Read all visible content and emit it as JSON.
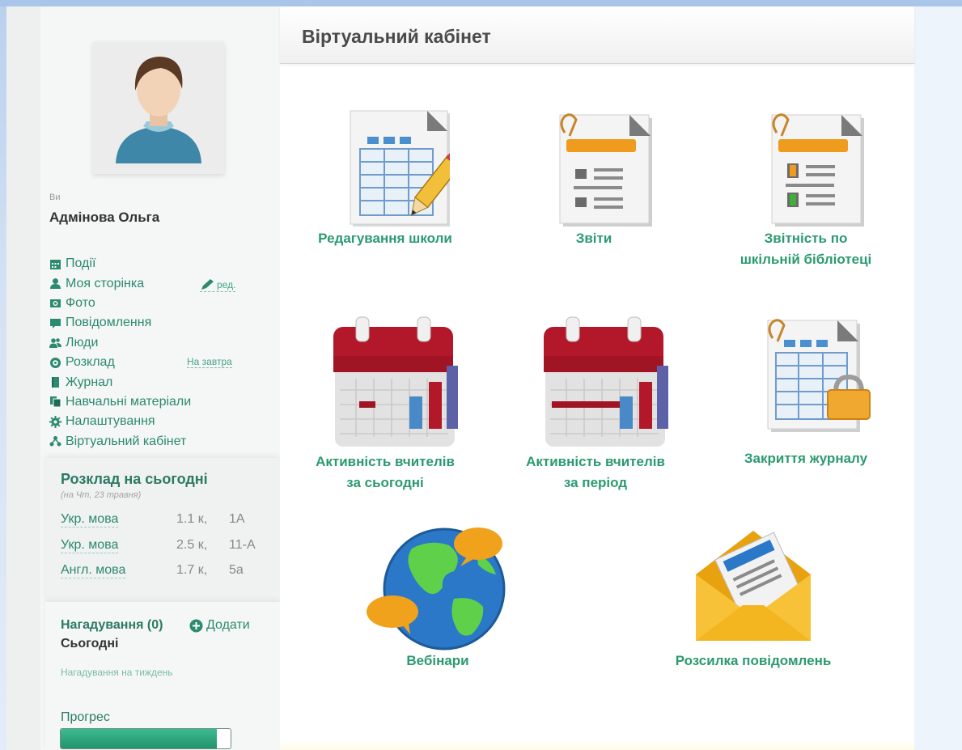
{
  "user": {
    "you_label": "Ви",
    "name": "Адмінова Ольга"
  },
  "menu": {
    "items": [
      {
        "label": "Події",
        "icon": "calendar-icon"
      },
      {
        "label": "Моя сторінка",
        "icon": "user-icon"
      },
      {
        "label": "Фото",
        "icon": "camera-icon"
      },
      {
        "label": "Повідомлення",
        "icon": "message-icon"
      },
      {
        "label": "Люди",
        "icon": "people-icon"
      },
      {
        "label": "Розклад",
        "icon": "clock-icon"
      },
      {
        "label": "Журнал",
        "icon": "book-icon"
      },
      {
        "label": "Навчальні матеріали",
        "icon": "documents-icon"
      },
      {
        "label": "Налаштування",
        "icon": "gear-icon"
      },
      {
        "label": "Віртуальний кабінет",
        "icon": "sitemap-icon"
      }
    ],
    "edit_label": "ред.",
    "tomorrow_label": "На завтра"
  },
  "schedule": {
    "title": "Розклад на сьогодні",
    "subtitle": "(на Чт, 23 травня)",
    "rows": [
      {
        "subject": "Укр. мова",
        "room": "1.1 к,",
        "class": "1А"
      },
      {
        "subject": "Укр. мова",
        "room": "2.5 к,",
        "class": "11-А"
      },
      {
        "subject": "Англ. мова",
        "room": "1.7 к,",
        "class": "5а"
      }
    ]
  },
  "reminders": {
    "title": "Нагадування (0)",
    "add_label": "Додати",
    "today": "Сьогодні",
    "week": "Нагадування на тиждень",
    "progress_label": "Прогрес",
    "progress_fraction": 0.92
  },
  "main": {
    "title": "Віртуальний кабінет",
    "tiles": [
      {
        "line1": "Редагування школи",
        "line2": "",
        "icon": "edit-table-icon"
      },
      {
        "line1": "Звіти",
        "line2": "",
        "icon": "report-icon"
      },
      {
        "line1": "Звітність по",
        "line2": "шкільній бібліотеці",
        "icon": "library-report-icon"
      },
      {
        "line1": "Активність вчителів",
        "line2": "за сьогодні",
        "icon": "calendar-chart-icon"
      },
      {
        "line1": "Активність вчителів",
        "line2": "за період",
        "icon": "calendar-period-icon"
      },
      {
        "line1": "Закриття журналу",
        "line2": "",
        "icon": "locked-journal-icon"
      },
      {
        "line1": "Вебінари",
        "line2": "",
        "icon": "globe-chat-icon"
      },
      {
        "line1": "Розсилка повідомлень",
        "line2": "",
        "icon": "envelope-icon"
      }
    ]
  },
  "colors": {
    "accent": "#2b9a70",
    "calendar_red": "#b3182a",
    "folder_orange": "#ee9b1e"
  }
}
